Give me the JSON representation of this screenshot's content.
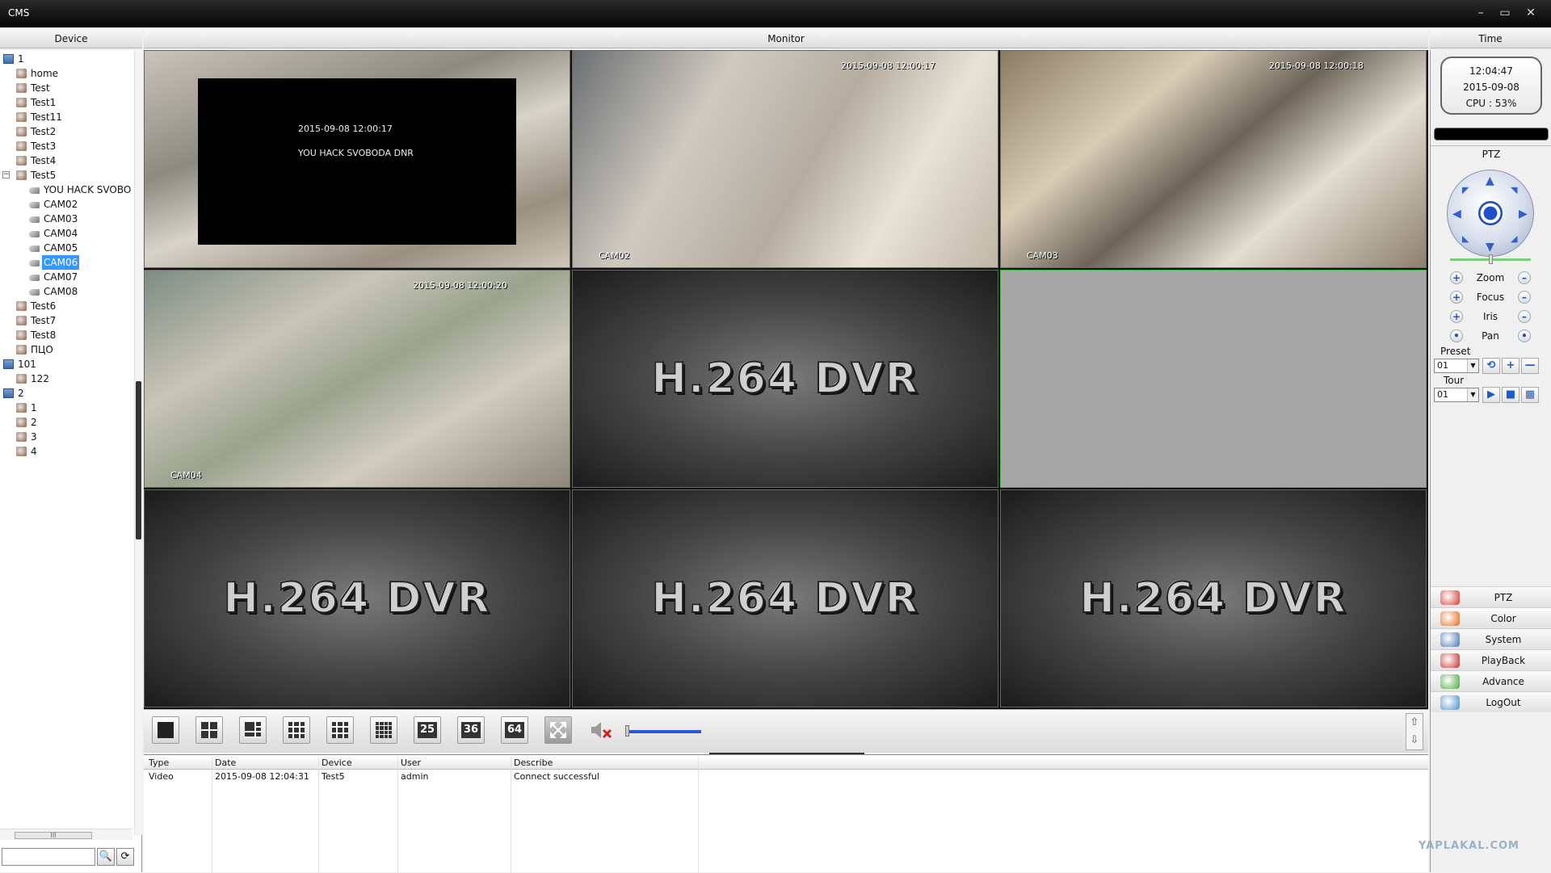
{
  "window": {
    "title": "CMS",
    "minimize": "–",
    "maximize": "▭",
    "close": "✕"
  },
  "headers": {
    "device": "Device",
    "monitor": "Monitor",
    "time": "Time"
  },
  "tree": [
    {
      "label": "1",
      "level": 0,
      "icon": "root"
    },
    {
      "label": "home",
      "level": 1,
      "icon": "dev"
    },
    {
      "label": "Test",
      "level": 1,
      "icon": "dev"
    },
    {
      "label": "Test1",
      "level": 1,
      "icon": "dev"
    },
    {
      "label": "Test11",
      "level": 1,
      "icon": "dev"
    },
    {
      "label": "Test2",
      "level": 1,
      "icon": "dev"
    },
    {
      "label": "Test3",
      "level": 1,
      "icon": "dev"
    },
    {
      "label": "Test4",
      "level": 1,
      "icon": "dev"
    },
    {
      "label": "Test5",
      "level": 1,
      "icon": "dev",
      "expanded": true
    },
    {
      "label": "YOU HACK SVOBO",
      "level": 2,
      "icon": "cam"
    },
    {
      "label": "CAM02",
      "level": 2,
      "icon": "cam"
    },
    {
      "label": "CAM03",
      "level": 2,
      "icon": "cam"
    },
    {
      "label": "CAM04",
      "level": 2,
      "icon": "cam"
    },
    {
      "label": "CAM05",
      "level": 2,
      "icon": "cam"
    },
    {
      "label": "CAM06",
      "level": 2,
      "icon": "cam",
      "selected": true
    },
    {
      "label": "CAM07",
      "level": 2,
      "icon": "cam"
    },
    {
      "label": "CAM08",
      "level": 2,
      "icon": "cam"
    },
    {
      "label": "Test6",
      "level": 1,
      "icon": "dev"
    },
    {
      "label": "Test7",
      "level": 1,
      "icon": "dev"
    },
    {
      "label": "Test8",
      "level": 1,
      "icon": "dev"
    },
    {
      "label": "ПЦО",
      "level": 1,
      "icon": "dev"
    },
    {
      "label": "101",
      "level": 0,
      "icon": "root"
    },
    {
      "label": "122",
      "level": 1,
      "icon": "dev"
    },
    {
      "label": "2",
      "level": 0,
      "icon": "root"
    },
    {
      "label": "1",
      "level": 1,
      "icon": "dev"
    },
    {
      "label": "2",
      "level": 1,
      "icon": "dev"
    },
    {
      "label": "3",
      "level": 1,
      "icon": "dev"
    },
    {
      "label": "4",
      "level": 1,
      "icon": "dev"
    }
  ],
  "tree_scroll_grip": "III",
  "search": {
    "placeholder": "",
    "search_icon": "🔍",
    "refresh_icon": "⟳"
  },
  "tiles": [
    {
      "type": "feed",
      "timestamp": "",
      "camera": "",
      "overlay_time": "2015-09-08 12:00:17",
      "overlay_text": "YOU HACK SVOBODA DNR"
    },
    {
      "type": "feed",
      "timestamp": "2015-09-08 12:00:17",
      "camera": "CAM02"
    },
    {
      "type": "feed",
      "timestamp": "2015-09-08 12:00:18",
      "camera": "CAM03"
    },
    {
      "type": "feed",
      "timestamp": "2015-09-08 12:00:20",
      "camera": "CAM04"
    },
    {
      "type": "dvr",
      "logo": "H.264 DVR"
    },
    {
      "type": "blank",
      "selected": true
    },
    {
      "type": "dvr",
      "logo": "H.264 DVR"
    },
    {
      "type": "dvr",
      "logo": "H.264 DVR"
    },
    {
      "type": "dvr",
      "logo": "H.264 DVR"
    }
  ],
  "layout_buttons": [
    "1",
    "4",
    "6",
    "8",
    "9",
    "13",
    "16",
    "25",
    "36",
    "64"
  ],
  "layout_labels": {
    "25": "25",
    "36": "36",
    "64": "64"
  },
  "volume": {
    "level": 0.75
  },
  "log": {
    "columns": [
      "Type",
      "Date",
      "Device",
      "User",
      "Describe"
    ],
    "rows": [
      [
        "Video",
        "2015-09-08 12:04:31",
        "Test5",
        "admin",
        "Connect successful"
      ]
    ]
  },
  "clock": {
    "time": "12:04:47",
    "date": "2015-09-08",
    "cpu": "CPU : 53%"
  },
  "ptz": {
    "title": "PTZ",
    "zoom": "Zoom",
    "focus": "Focus",
    "iris": "Iris",
    "pan": "Pan",
    "plus": "+",
    "minus": "–",
    "dot": "•",
    "preset_label": "Preset",
    "preset_value": "01",
    "tour_label": "Tour",
    "tour_value": "01"
  },
  "menu": [
    {
      "label": "PTZ",
      "color": "#d9372f"
    },
    {
      "label": "Color",
      "color": "#e56b1f"
    },
    {
      "label": "System",
      "color": "#4a77b5"
    },
    {
      "label": "PlayBack",
      "color": "#c8302b"
    },
    {
      "label": "Advance",
      "color": "#4aa83f"
    },
    {
      "label": "LogOut",
      "color": "#4d8fcf"
    }
  ],
  "watermark": "YAPLAKAL.COM"
}
